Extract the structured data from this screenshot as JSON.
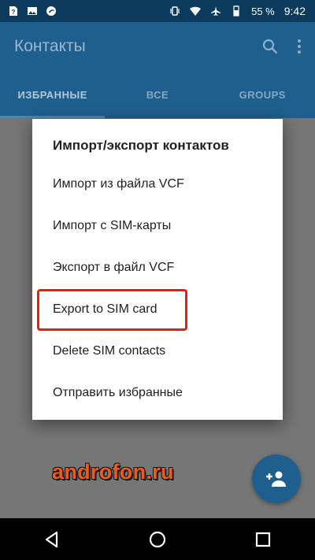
{
  "status_bar": {
    "battery": "55 %",
    "time": "9:42",
    "icons": [
      "sim-question-icon",
      "image-icon",
      "edge-icon",
      "vibrate-icon",
      "wifi-icon",
      "airplane-icon",
      "battery-icon"
    ]
  },
  "app_bar": {
    "title": "Контакты",
    "icons": [
      "search-icon",
      "more-vert-icon"
    ]
  },
  "tabs": [
    {
      "label": "ИЗБРАННЫЕ",
      "active": true
    },
    {
      "label": "ВСЕ",
      "active": false
    },
    {
      "label": "GROUPS",
      "active": false
    }
  ],
  "dialog": {
    "title": "Импорт/экспорт контактов",
    "items": [
      {
        "label": "Импорт из файла VCF"
      },
      {
        "label": "Импорт с SIM-карты"
      },
      {
        "label": "Экспорт в файл VCF"
      },
      {
        "label": "Export to SIM card"
      },
      {
        "label": "Delete SIM contacts"
      },
      {
        "label": "Отправить избранные"
      }
    ]
  },
  "fab": {
    "icon": "add-person-icon"
  },
  "watermark": "androfon.ru",
  "nav_bar": {
    "icons": [
      "back-icon",
      "home-icon",
      "recents-icon"
    ]
  },
  "colors": {
    "status_bar": "#0b3a5c",
    "app_bar": "#1f5f8f",
    "highlight": "#e0201f",
    "watermark": "#ee5a1e"
  }
}
